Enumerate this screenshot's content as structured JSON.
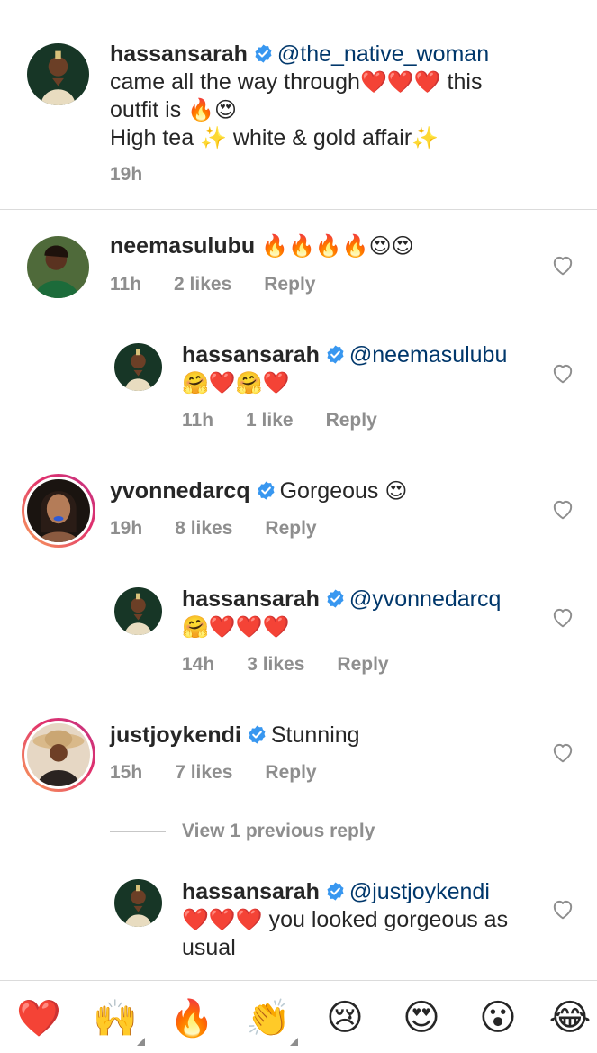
{
  "caption": {
    "username": "hassansarah",
    "mention": "@the_native_woman",
    "line1_text": "came all the way through",
    "line1_emoji": "❤️❤️❤️",
    "line1_tail": " this",
    "line2_text": "outfit is ",
    "line2_emoji": "🔥😍",
    "line3_text": "High tea ",
    "line3_emoji1": "✨",
    "line3_mid": " white & gold affair",
    "line3_emoji2": "✨",
    "time": "19h"
  },
  "comments": [
    {
      "username": "neemasulubu",
      "text": "",
      "emoji": "🔥🔥🔥🔥😍😍",
      "time": "11h",
      "likes": "2 likes",
      "reply": "Reply",
      "reply_item": {
        "username": "hassansarah",
        "mention": "@neemasulubu",
        "emoji": "🤗❤️🤗❤️",
        "time": "11h",
        "likes": "1 like",
        "reply": "Reply"
      }
    },
    {
      "username": "yvonnedarcq",
      "text": "Gorgeous ",
      "emoji": "😍",
      "time": "19h",
      "likes": "8 likes",
      "reply": "Reply",
      "reply_item": {
        "username": "hassansarah",
        "mention": "@yvonnedarcq",
        "emoji": "🤗❤️❤️❤️",
        "time": "14h",
        "likes": "3 likes",
        "reply": "Reply"
      }
    },
    {
      "username": "justjoykendi",
      "text": "Stunning",
      "emoji": "",
      "time": "15h",
      "likes": "7 likes",
      "reply": "Reply",
      "view_replies": "View 1 previous reply",
      "reply_item": {
        "username": "hassansarah",
        "mention": "@justjoykendi",
        "emoji": "❤️❤️❤️",
        "text": " you looked gorgeous as",
        "text2": "usual"
      }
    }
  ],
  "reactions": [
    "❤️",
    "🙌",
    "🔥",
    "👏",
    "😢",
    "😍",
    "😮",
    "😂"
  ],
  "colors": {
    "mention": "#00376b",
    "verified": "#3897f0",
    "meta": "#8e8e8e",
    "story_ring_start": "#f9a35a",
    "story_ring_end": "#c13584"
  }
}
